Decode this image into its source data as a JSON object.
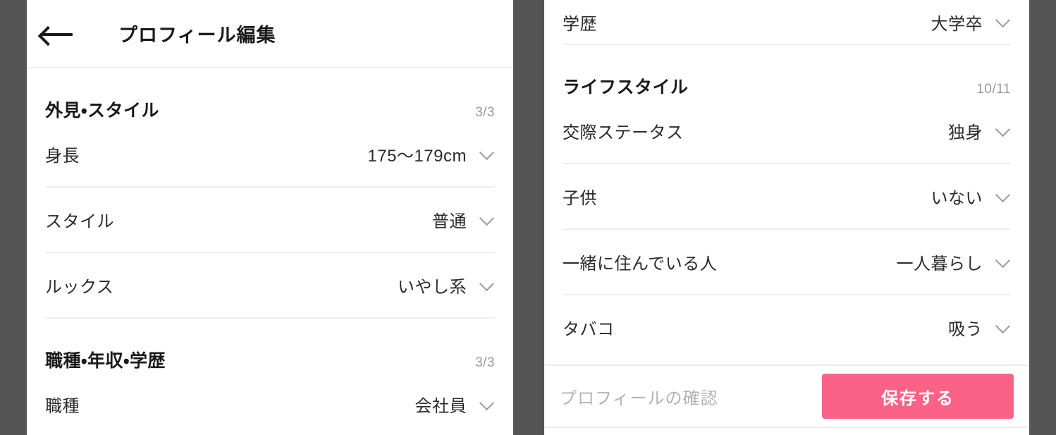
{
  "theme": {
    "backdrop": "#555555",
    "panel_bg": "#ffffff",
    "accent_pink": "#fa6288",
    "divider": "#eeeeee",
    "muted_text": "#9a9a9a",
    "primary_text": "#1a1a1a"
  },
  "header": {
    "back_icon": "arrow-left-icon",
    "title": "プロフィール編集"
  },
  "left_panel": {
    "sections": [
      {
        "title": "外見・スタイル",
        "count": "3/3",
        "rows": [
          {
            "label": "身長",
            "value": "175〜179cm",
            "icon": "chevron-down-icon"
          },
          {
            "label": "スタイル",
            "value": "普通",
            "icon": "chevron-down-icon"
          },
          {
            "label": "ルックス",
            "value": "いやし系",
            "icon": "chevron-down-icon"
          }
        ]
      },
      {
        "title": "職種・年収・学歴",
        "count": "3/3",
        "rows": [
          {
            "label": "職種",
            "value": "会社員",
            "icon": "chevron-down-icon"
          }
        ]
      }
    ]
  },
  "right_panel": {
    "top_rows": [
      {
        "label": "学歴",
        "value": "大学卒",
        "icon": "chevron-down-icon"
      }
    ],
    "sections": [
      {
        "title": "ライフスタイル",
        "count": "10/11",
        "rows": [
          {
            "label": "交際ステータス",
            "value": "独身",
            "icon": "chevron-down-icon"
          },
          {
            "label": "子供",
            "value": "いない",
            "icon": "chevron-down-icon"
          },
          {
            "label": "一緒に住んでいる人",
            "value": "一人暮らし",
            "icon": "chevron-down-icon"
          },
          {
            "label": "タバコ",
            "value": "吸う",
            "icon": "chevron-down-icon"
          }
        ]
      }
    ],
    "bottom_bar": {
      "link_label": "プロフィールの確認",
      "save_label": "保存する"
    }
  }
}
